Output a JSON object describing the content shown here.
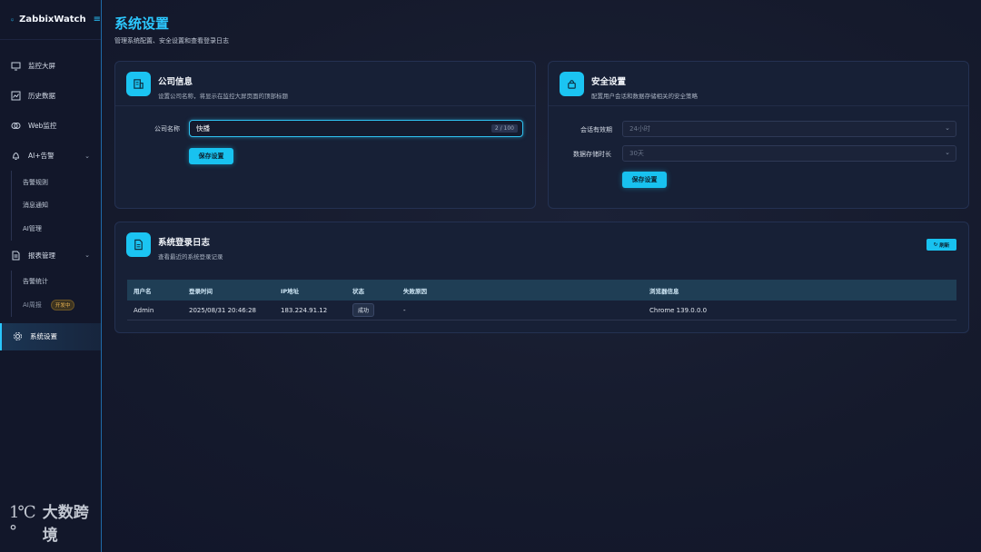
{
  "app": {
    "brand": "ZabbixWatch",
    "toggle_icon": "menu-icon"
  },
  "sidebar": {
    "items": [
      {
        "label": "监控大屏",
        "icon": "monitor-icon"
      },
      {
        "label": "历史数据",
        "icon": "chart-icon"
      },
      {
        "label": "Web监控",
        "icon": "web-icon"
      },
      {
        "label": "AI+告警",
        "icon": "bell-icon",
        "expanded": true
      },
      {
        "label": "报表管理",
        "icon": "report-icon",
        "expanded": true
      },
      {
        "label": "系统设置",
        "icon": "gear-icon",
        "active": true
      }
    ],
    "alarm_sub": [
      "告警规则",
      "消息通知",
      "AI管理"
    ],
    "report_sub": [
      "告警统计",
      "AI周报"
    ],
    "dev_badge": "开发中"
  },
  "page": {
    "title": "系统设置",
    "subtitle": "管理系统配置、安全设置和查看登录日志"
  },
  "company_card": {
    "title": "公司信息",
    "desc": "设置公司名称，将显示在监控大屏页面的顶部标题",
    "label": "公司名称",
    "value": "快播",
    "count": "2 / 100",
    "save": "保存设置"
  },
  "security_card": {
    "title": "安全设置",
    "desc": "配置用户会话和数据存储相关的安全策略",
    "session_label": "会话有效期",
    "session_value": "24小时",
    "storage_label": "数据存储时长",
    "storage_value": "30天",
    "save": "保存设置"
  },
  "log_card": {
    "title": "系统登录日志",
    "desc": "查看最近的系统登录记录",
    "refresh": "刷新",
    "columns": [
      "用户名",
      "登录时间",
      "IP地址",
      "状态",
      "失败原因",
      "浏览器信息"
    ],
    "rows": [
      {
        "user": "Admin",
        "time": "2025/08/31 20:46:28",
        "ip": "183.224.91.12",
        "status": "成功",
        "reason": "-",
        "browser": "Chrome 139.0.0.0"
      }
    ]
  },
  "watermark": {
    "mark": "1℃°",
    "text": "大数跨境"
  },
  "colors": {
    "accent": "#18c2f0",
    "title": "#2cc8ff",
    "bg": "#151a2c"
  }
}
